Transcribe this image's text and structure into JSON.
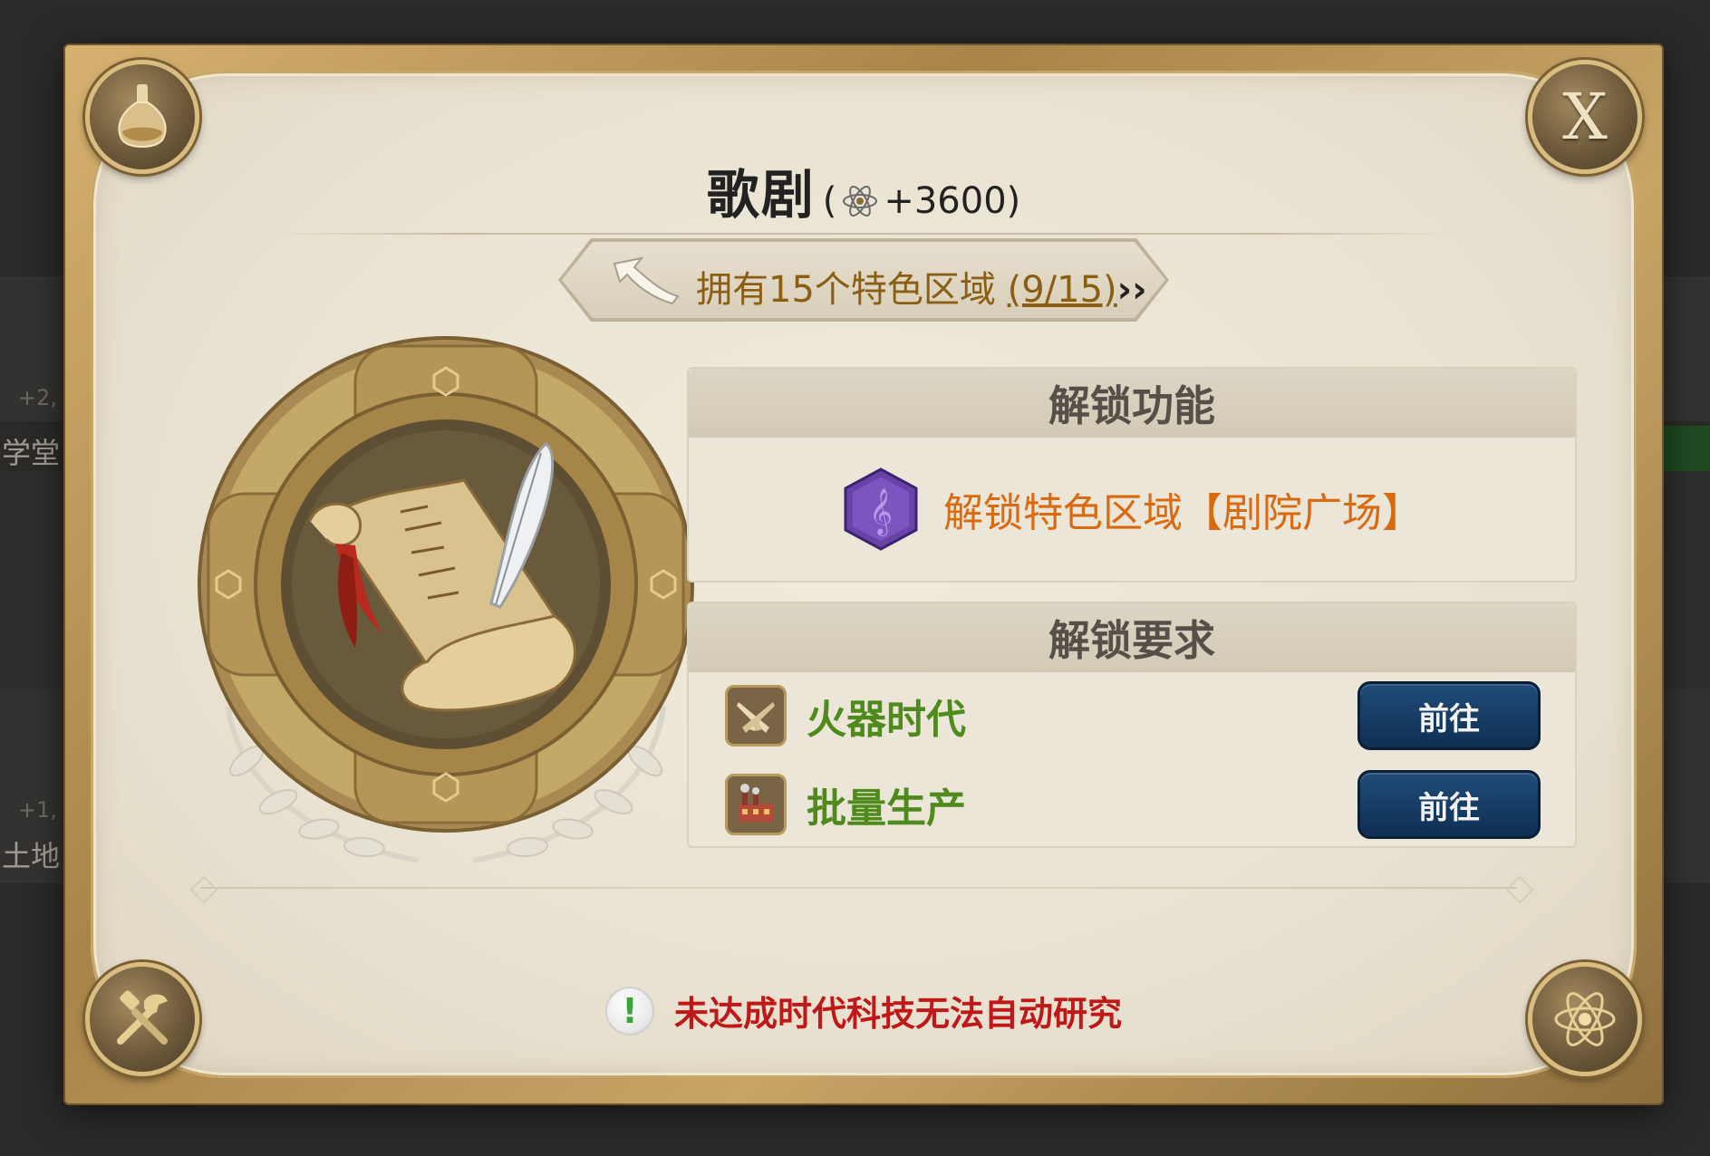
{
  "background": {
    "labels": [
      "学堂",
      "土地"
    ],
    "faded": [
      "+2,",
      "+1,"
    ]
  },
  "dialog": {
    "title": "歌剧",
    "bonus": "+3600",
    "close_label": "X",
    "goal": {
      "text": "拥有15个特色区域",
      "progress": "(9/15)",
      "chevrons": "››"
    },
    "unlock_section": {
      "header": "解锁功能",
      "item": "解锁特色区域【剧院广场】"
    },
    "requirements_section": {
      "header": "解锁要求",
      "items": [
        {
          "label": "火器时代",
          "button": "前往",
          "icon": "crossed-pistols-icon"
        },
        {
          "label": "批量生产",
          "button": "前往",
          "icon": "factory-icon"
        }
      ]
    },
    "warning": "未达成时代科技无法自动研究",
    "corner_icons": [
      "flask-icon",
      "close-icon",
      "tools-icon",
      "atom-icon"
    ]
  },
  "colors": {
    "goal_text": "#8a5f14",
    "unlock_text": "#d96a10",
    "requirement_text": "#4e8a1c",
    "warning_text": "#c01818",
    "button_bg": "#1f4c79"
  }
}
